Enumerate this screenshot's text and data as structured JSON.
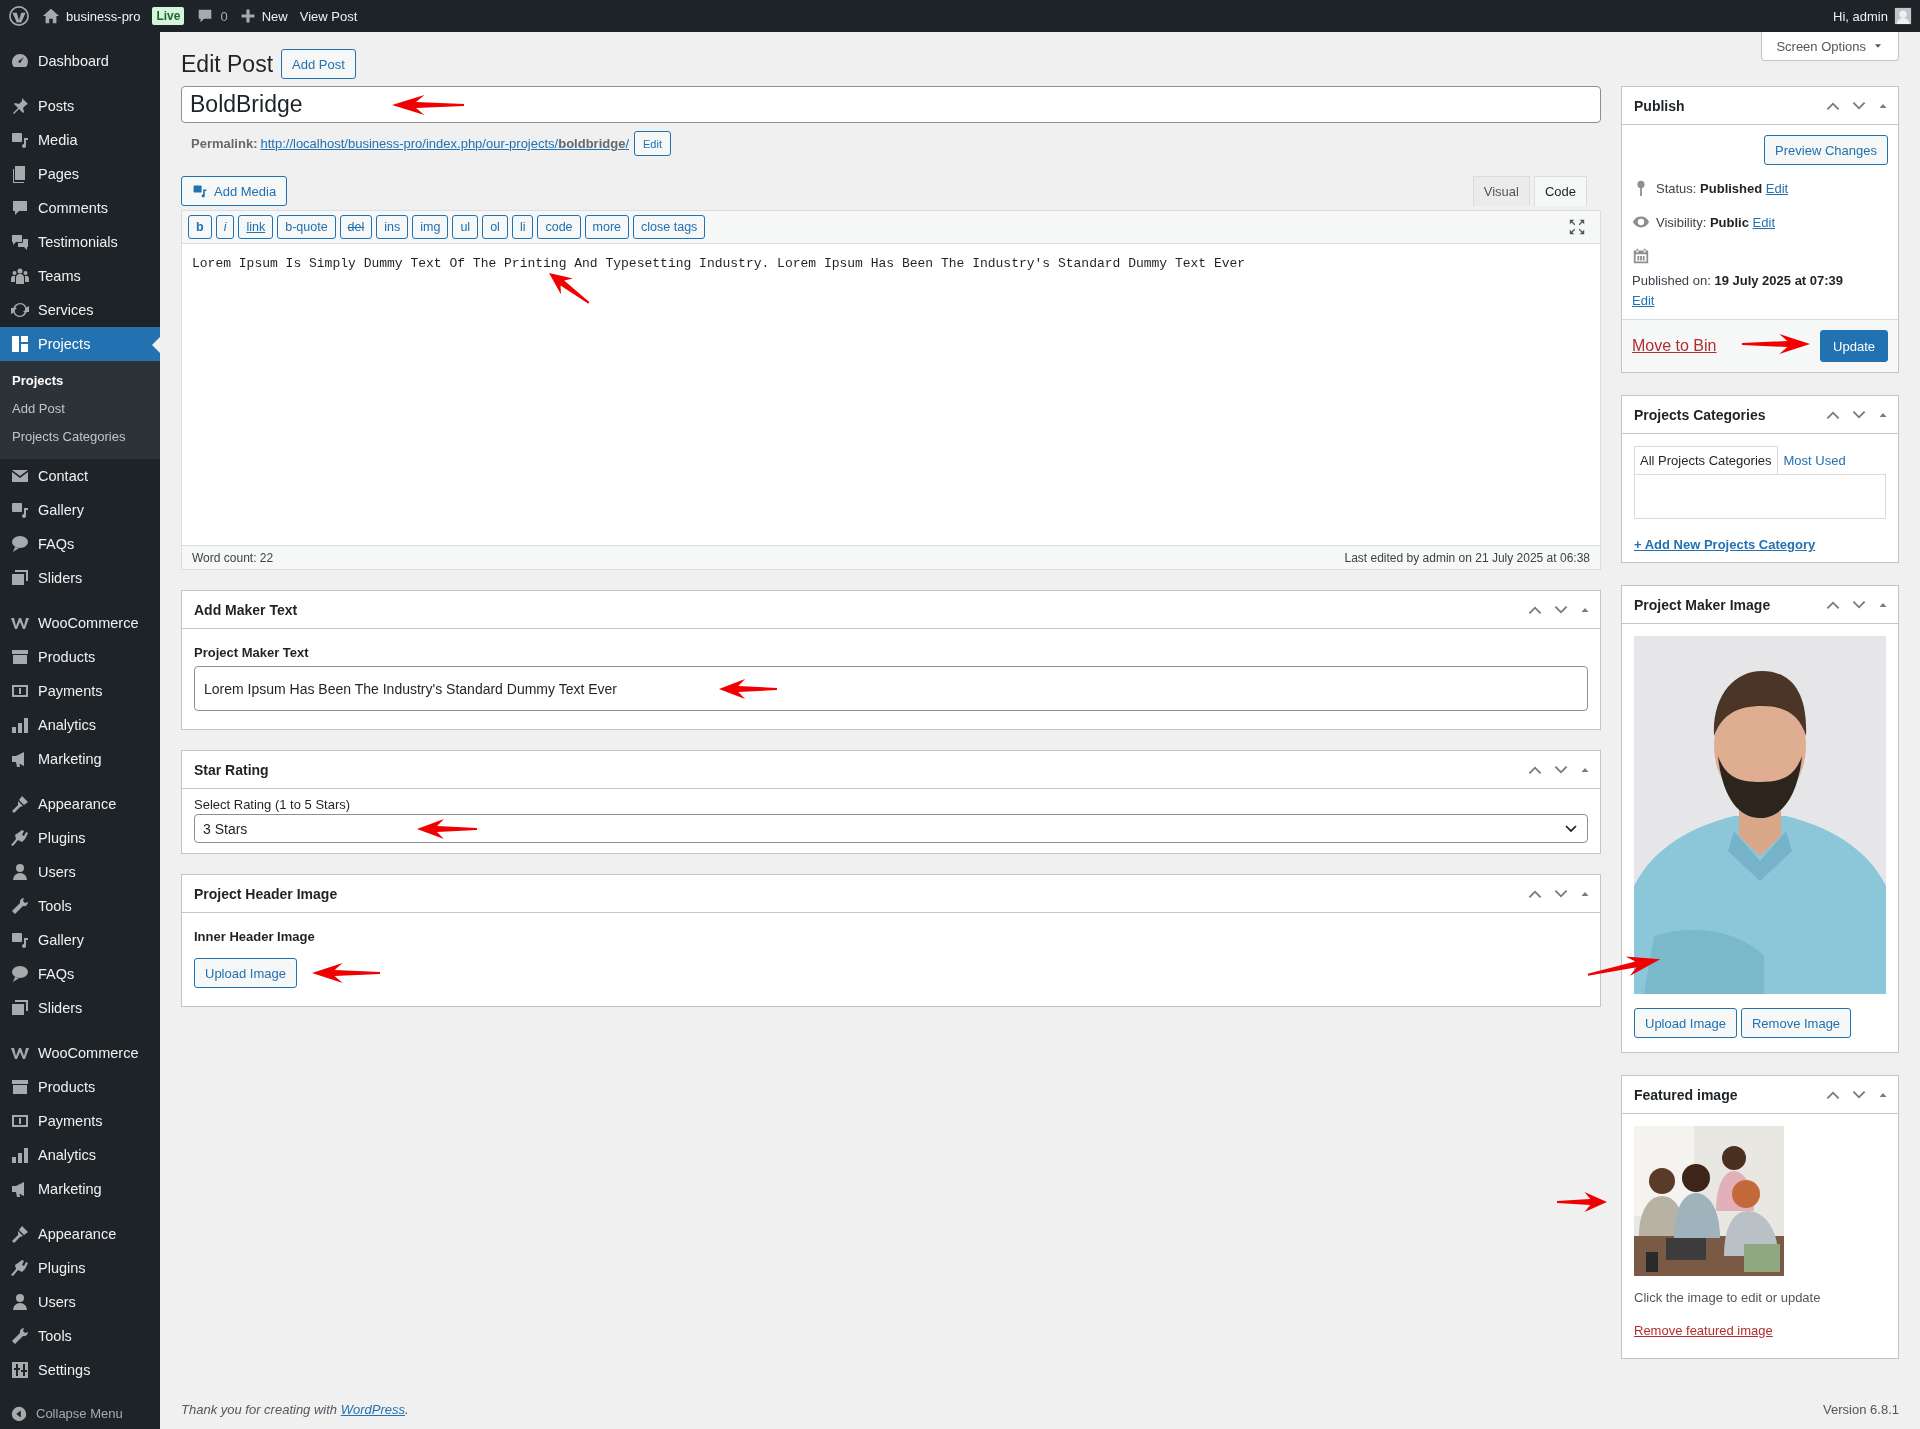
{
  "admin_bar": {
    "site": "business-pro",
    "badge": "Live",
    "comments": "0",
    "new": "New",
    "view": "View Post",
    "greeting": "Hi, admin"
  },
  "menu_groups": [
    [
      {
        "label": "Dashboard",
        "selected": false
      }
    ],
    [
      {
        "label": "Posts",
        "selected": false
      },
      {
        "label": "Media",
        "selected": false
      },
      {
        "label": "Pages",
        "selected": false
      },
      {
        "label": "Comments",
        "selected": false
      },
      {
        "label": "Testimonials",
        "selected": false
      },
      {
        "label": "Teams",
        "selected": false
      },
      {
        "label": "Services",
        "selected": false
      },
      {
        "label": "Projects",
        "selected": true,
        "children": [
          {
            "label": "Projects",
            "selected": true
          },
          {
            "label": "Add Post",
            "selected": false
          },
          {
            "label": "Projects Categories",
            "selected": false
          }
        ]
      },
      {
        "label": "Contact",
        "selected": false
      },
      {
        "label": "Gallery",
        "selected": false
      },
      {
        "label": "FAQs",
        "selected": false
      },
      {
        "label": "Sliders",
        "selected": false
      }
    ],
    [
      {
        "label": "WooCommerce",
        "selected": false
      },
      {
        "label": "Products",
        "selected": false
      },
      {
        "label": "Payments",
        "selected": false
      },
      {
        "label": "Analytics",
        "selected": false
      },
      {
        "label": "Marketing",
        "selected": false
      }
    ],
    [
      {
        "label": "Appearance",
        "selected": false
      },
      {
        "label": "Plugins",
        "selected": false
      },
      {
        "label": "Users",
        "selected": false
      },
      {
        "label": "Tools",
        "selected": false
      },
      {
        "label": "Gallery",
        "selected": false
      },
      {
        "label": "FAQs",
        "selected": false
      },
      {
        "label": "Sliders",
        "selected": false
      }
    ],
    [
      {
        "label": "WooCommerce",
        "selected": false
      },
      {
        "label": "Products",
        "selected": false
      },
      {
        "label": "Payments",
        "selected": false
      },
      {
        "label": "Analytics",
        "selected": false
      },
      {
        "label": "Marketing",
        "selected": false
      }
    ],
    [
      {
        "label": "Appearance",
        "selected": false
      },
      {
        "label": "Plugins",
        "selected": false
      },
      {
        "label": "Users",
        "selected": false
      },
      {
        "label": "Tools",
        "selected": false
      },
      {
        "label": "Settings",
        "selected": false
      }
    ]
  ],
  "collapse_menu": "Collapse Menu",
  "page_title": "Edit Post",
  "add_new": "Add Post",
  "screen_options": "Screen Options",
  "post_title": "BoldBridge",
  "permalink": {
    "label": "Permalink:",
    "url": "http://localhost/business-pro/index.php/our-projects/**boldbridge**/",
    "edit": "Edit"
  },
  "editor": {
    "add_media": "Add Media",
    "tabs": [
      {
        "label": "Visual",
        "selected": false
      },
      {
        "label": "Code",
        "selected": true
      }
    ],
    "quicktags": [
      {
        "label": "b",
        "kind": "bold"
      },
      {
        "label": "i",
        "kind": "italic"
      },
      {
        "label": "link",
        "kind": "link"
      },
      {
        "label": "b-quote",
        "kind": "plain"
      },
      {
        "label": "del",
        "kind": "strike"
      },
      {
        "label": "ins",
        "kind": "plain"
      },
      {
        "label": "img",
        "kind": "plain"
      },
      {
        "label": "ul",
        "kind": "plain"
      },
      {
        "label": "ol",
        "kind": "plain"
      },
      {
        "label": "li",
        "kind": "plain"
      },
      {
        "label": "code",
        "kind": "plain"
      },
      {
        "label": "more",
        "kind": "plain"
      },
      {
        "label": "close tags",
        "kind": "plain"
      }
    ],
    "content": "Lorem Ipsum Is Simply Dummy Text Of The Printing And Typesetting Industry. Lorem Ipsum Has Been The Industry's Standard Dummy Text Ever",
    "word_count": "Word count: 22",
    "last_edited": "Last edited by admin on 21 July 2025 at 06:38"
  },
  "meta_boxes": [
    {
      "kind": "text",
      "title": "Add Maker Text",
      "label": "Project Maker Text",
      "value": "Lorem Ipsum Has Been The Industry's Standard Dummy Text Ever"
    },
    {
      "kind": "select",
      "title": "Star Rating",
      "label": "Select Rating (1 to 5 Stars)",
      "value": "3 Stars"
    },
    {
      "kind": "upload",
      "title": "Project Header Image",
      "label": "Inner Header Image",
      "button": "Upload Image"
    }
  ],
  "side_boxes": [
    {
      "kind": "publish",
      "title": "Publish",
      "preview": "Preview Changes",
      "rows": [
        {
          "text": "Status: **Published**",
          "link": "Edit"
        },
        {
          "text": "Visibility: **Public**",
          "link": "Edit"
        },
        {
          "text": "Published on: **19 July 2025 at 07:39**",
          "link": "Edit"
        }
      ],
      "trash": "Move to Bin",
      "update": "Update"
    },
    {
      "kind": "categories",
      "title": "Projects Categories",
      "tabs": [
        {
          "label": "All Projects Categories",
          "selected": true
        },
        {
          "label": "Most Used",
          "selected": false
        }
      ],
      "add_link": "+ Add New Projects Category"
    },
    {
      "kind": "maker_image",
      "title": "Project Maker Image",
      "buttons": [
        "Upload Image",
        "Remove Image"
      ]
    },
    {
      "kind": "featured",
      "title": "Featured image",
      "hint": "Click the image to edit or update",
      "remove": "Remove featured image"
    }
  ],
  "footer": {
    "thanks": "Thank you for creating with ",
    "link": "WordPress",
    "thanks_end": ".",
    "version": "Version 6.8.1"
  }
}
